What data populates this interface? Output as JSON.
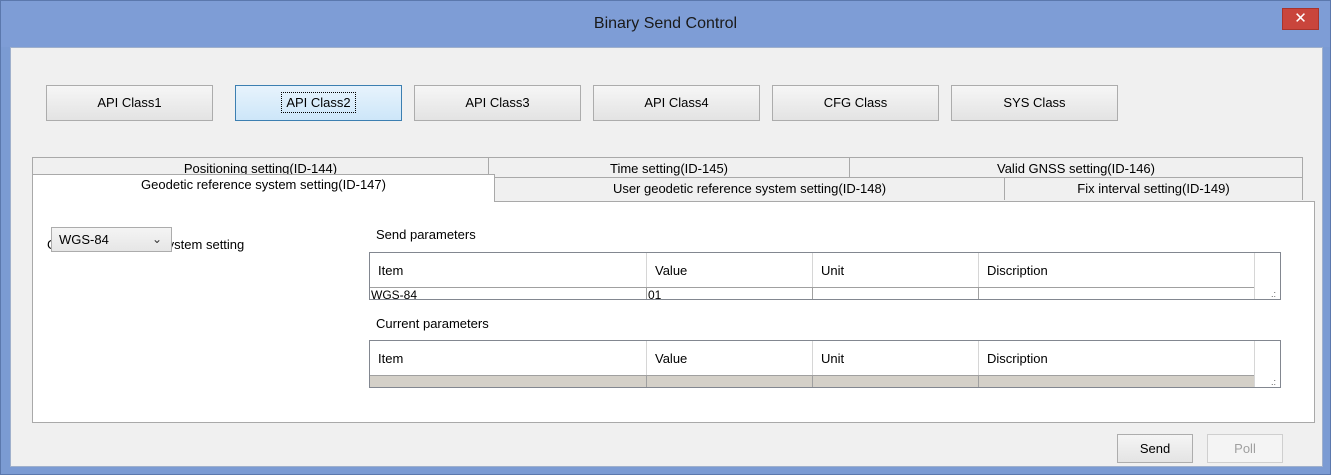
{
  "window": {
    "title": "Binary Send Control",
    "close_glyph": "✕"
  },
  "class_buttons": [
    {
      "label": "API Class1"
    },
    {
      "label": "API Class2"
    },
    {
      "label": "API Class3"
    },
    {
      "label": "API Class4"
    },
    {
      "label": "CFG Class"
    },
    {
      "label": "SYS Class"
    }
  ],
  "tabs": {
    "row1": [
      {
        "label": "Positioning setting(ID-144)"
      },
      {
        "label": "Time setting(ID-145)"
      },
      {
        "label": "Valid GNSS setting(ID-146)"
      }
    ],
    "row2": [
      {
        "label": "Geodetic reference system setting(ID-147)"
      },
      {
        "label": "User geodetic reference system setting(ID-148)"
      },
      {
        "label": "Fix interval setting(ID-149)"
      }
    ]
  },
  "panel": {
    "setting_label": "Geodetic reference system setting",
    "select_value": "WGS-84",
    "select_icon": "chevron-down-icon",
    "send_params_label": "Send parameters",
    "current_params_label": "Current parameters",
    "columns": [
      "Item",
      "Value",
      "Unit",
      "Discription"
    ],
    "send_row": [
      "WGS-84",
      "01",
      "",
      ""
    ],
    "current_row": [
      "",
      "",
      "",
      ""
    ]
  },
  "buttons": {
    "send": "Send",
    "poll": "Poll"
  }
}
